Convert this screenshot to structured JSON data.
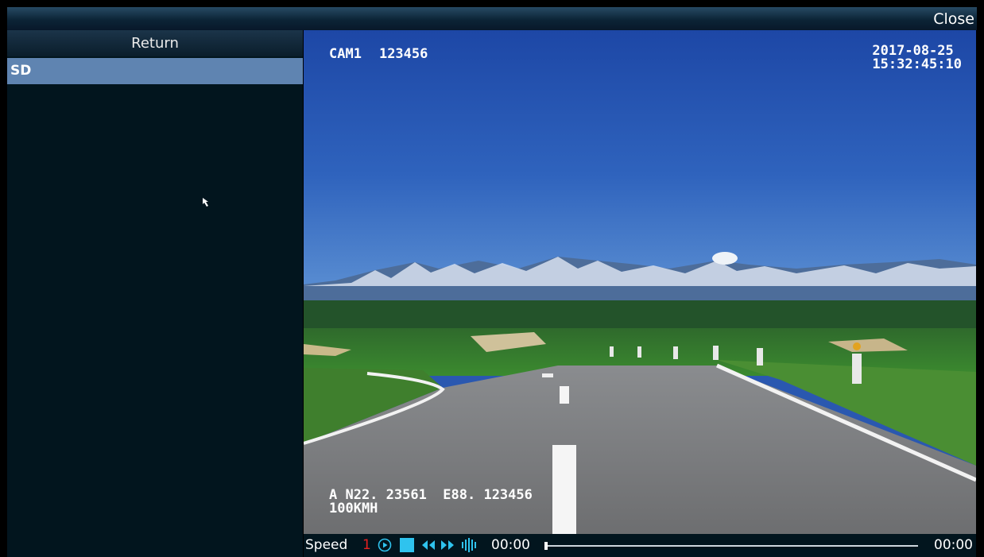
{
  "window": {
    "close_label": "Close"
  },
  "sidebar": {
    "return_label": "Return",
    "items": [
      {
        "label": "SD",
        "selected": true
      }
    ]
  },
  "video": {
    "camera": "CAM1",
    "device_id": "123456",
    "date": "2017-08-25",
    "time": "15:32:45:10",
    "gps": "A N22. 23561  E88. 123456",
    "speed": "100KMH"
  },
  "controls": {
    "speed_label": "Speed",
    "speed_value": "1",
    "current_time": "00:00",
    "total_time": "00:00",
    "progress": 0,
    "accent_color": "#2fc3ee",
    "speed_value_color": "#e62020",
    "icons": [
      "play-icon",
      "stop-icon",
      "rewind-icon",
      "fast-forward-icon",
      "frame-step-icon"
    ]
  }
}
